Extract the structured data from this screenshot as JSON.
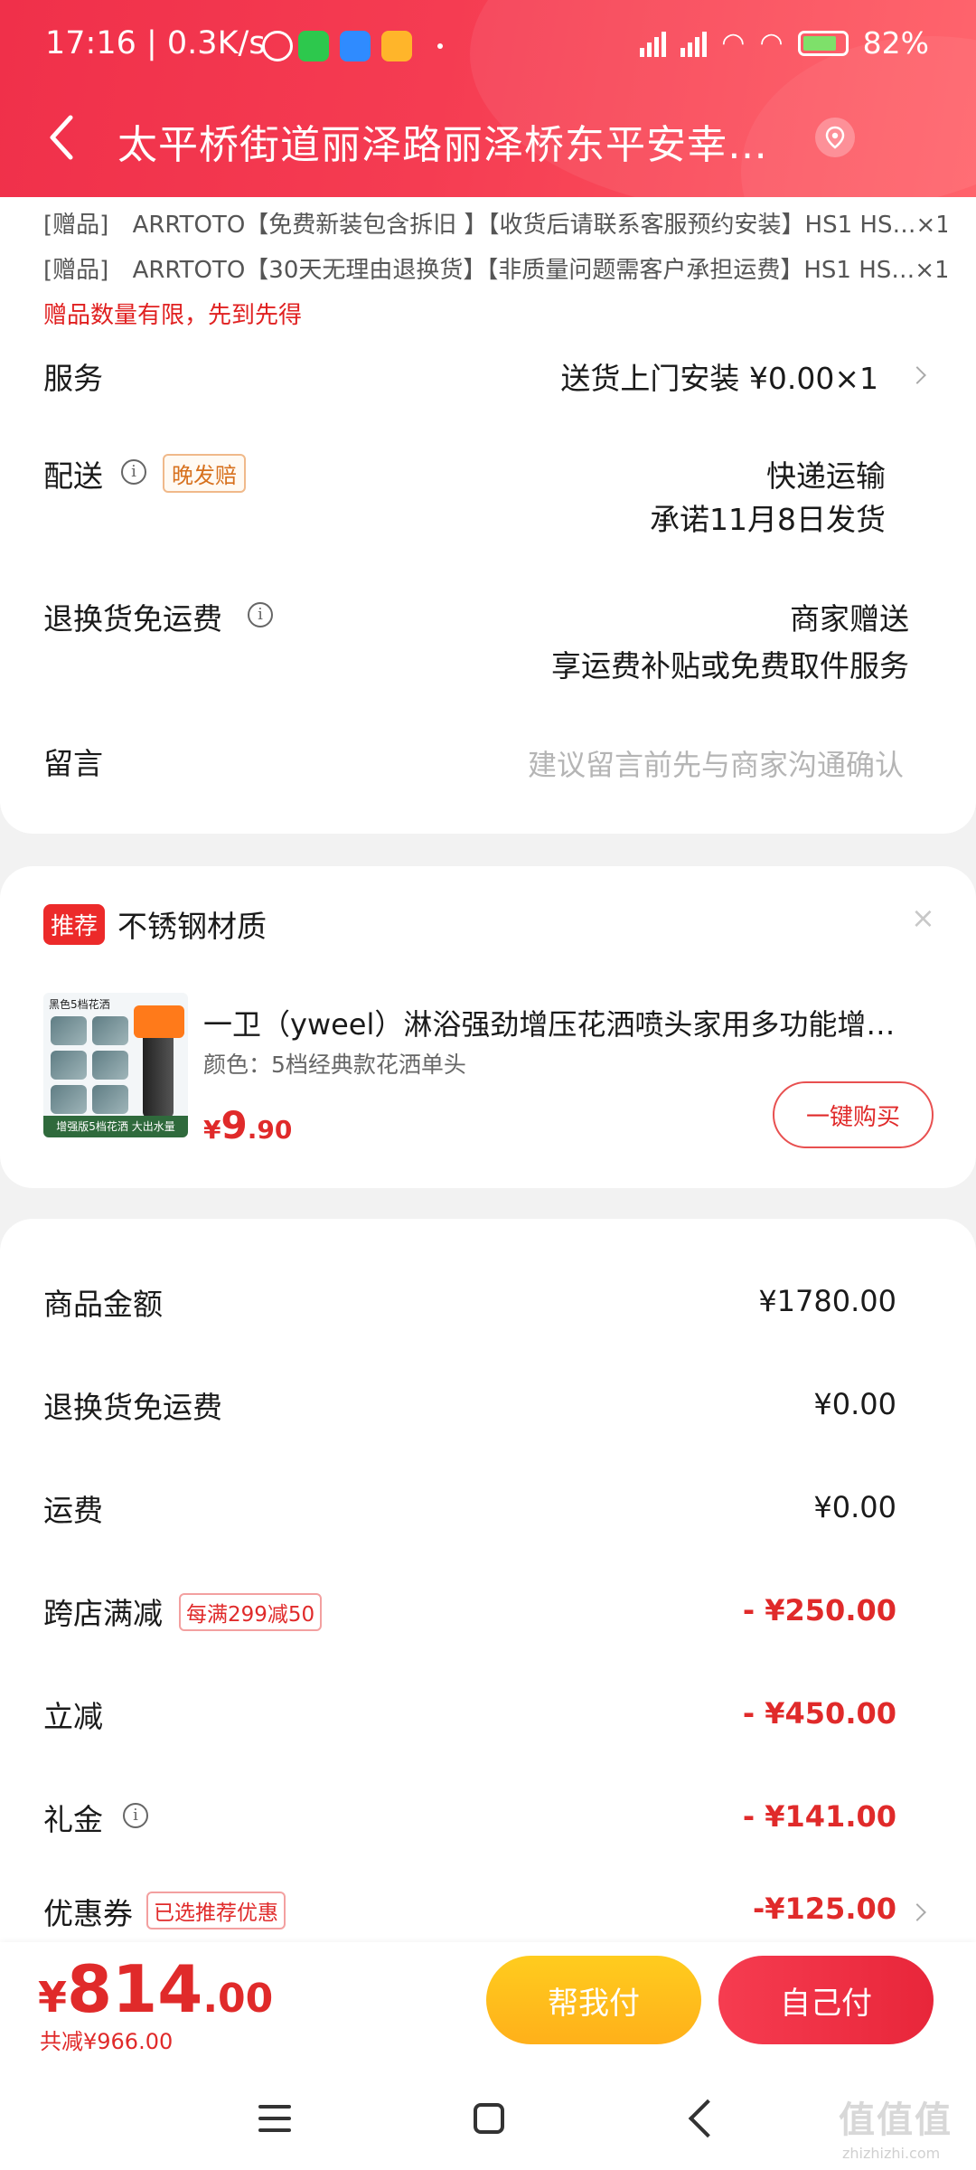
{
  "status_bar": {
    "time": "17:16 | 0.3K/s",
    "battery": "82%"
  },
  "header": {
    "address": "太平桥街道丽泽路丽泽桥东平安幸…"
  },
  "gifts": [
    {
      "tag": "[赠品]",
      "text": "ARRTOTO【免费新装包含拆旧 】【收货后请联系客服预约安装】HS1 HS…",
      "qty": "×1"
    },
    {
      "tag": "[赠品]",
      "text": "ARRTOTO【30天无理由退换货】【非质量问题需客户承担运费】HS1 HS…",
      "qty": "×1"
    }
  ],
  "gift_warning": "赠品数量有限，先到先得",
  "service": {
    "label": "服务",
    "value": "送货上门安装 ¥0.00×1"
  },
  "delivery": {
    "label": "配送",
    "tag": "晚发赔",
    "method": "快递运输",
    "promise": "承诺11月8日发货"
  },
  "return_shipping": {
    "label": "退换货免运费",
    "value1": "商家赠送",
    "value2": "享运费补贴或免费取件服务"
  },
  "message": {
    "label": "留言",
    "placeholder": "建议留言前先与商家沟通确认"
  },
  "recommend": {
    "badge": "推荐",
    "text": "不锈钢材质",
    "close": "×",
    "thumb_title": "黑色5档花洒",
    "thumb_banner": "增强版5档花洒 大出水量",
    "product_title": "一卫（yweel）淋浴强劲增压花洒喷头家用多功能增…",
    "product_spec": "颜色：5档经典款花洒单头",
    "price_symbol": "¥",
    "price_int": "9",
    "price_dec": ".90",
    "buy_label": "一键购买"
  },
  "pricing": [
    {
      "label": "商品金额",
      "value": "¥1780.00"
    },
    {
      "label": "退换货免运费",
      "value": "¥0.00"
    },
    {
      "label": "运费",
      "value": "¥0.00"
    },
    {
      "label": "跨店满减",
      "tag": "每满299减50",
      "value": "- ¥250.00"
    },
    {
      "label": "立减",
      "value": "- ¥450.00"
    },
    {
      "label": "礼金",
      "value": "- ¥141.00"
    },
    {
      "label": "优惠券",
      "tag": "已选推荐优惠",
      "value": "-¥125.00"
    }
  ],
  "bottom": {
    "currency": "¥",
    "total_int": "814",
    "total_dec": ".00",
    "saved": "共减¥966.00",
    "help_pay": "帮我付",
    "self_pay": "自己付"
  },
  "watermark": {
    "text": "值值值",
    "sub": "zhizhizhi.com"
  },
  "colors": {
    "brand_red": "#f0304a",
    "price_red": "#e02a2a",
    "help_yellow": "#ffbe1d"
  }
}
